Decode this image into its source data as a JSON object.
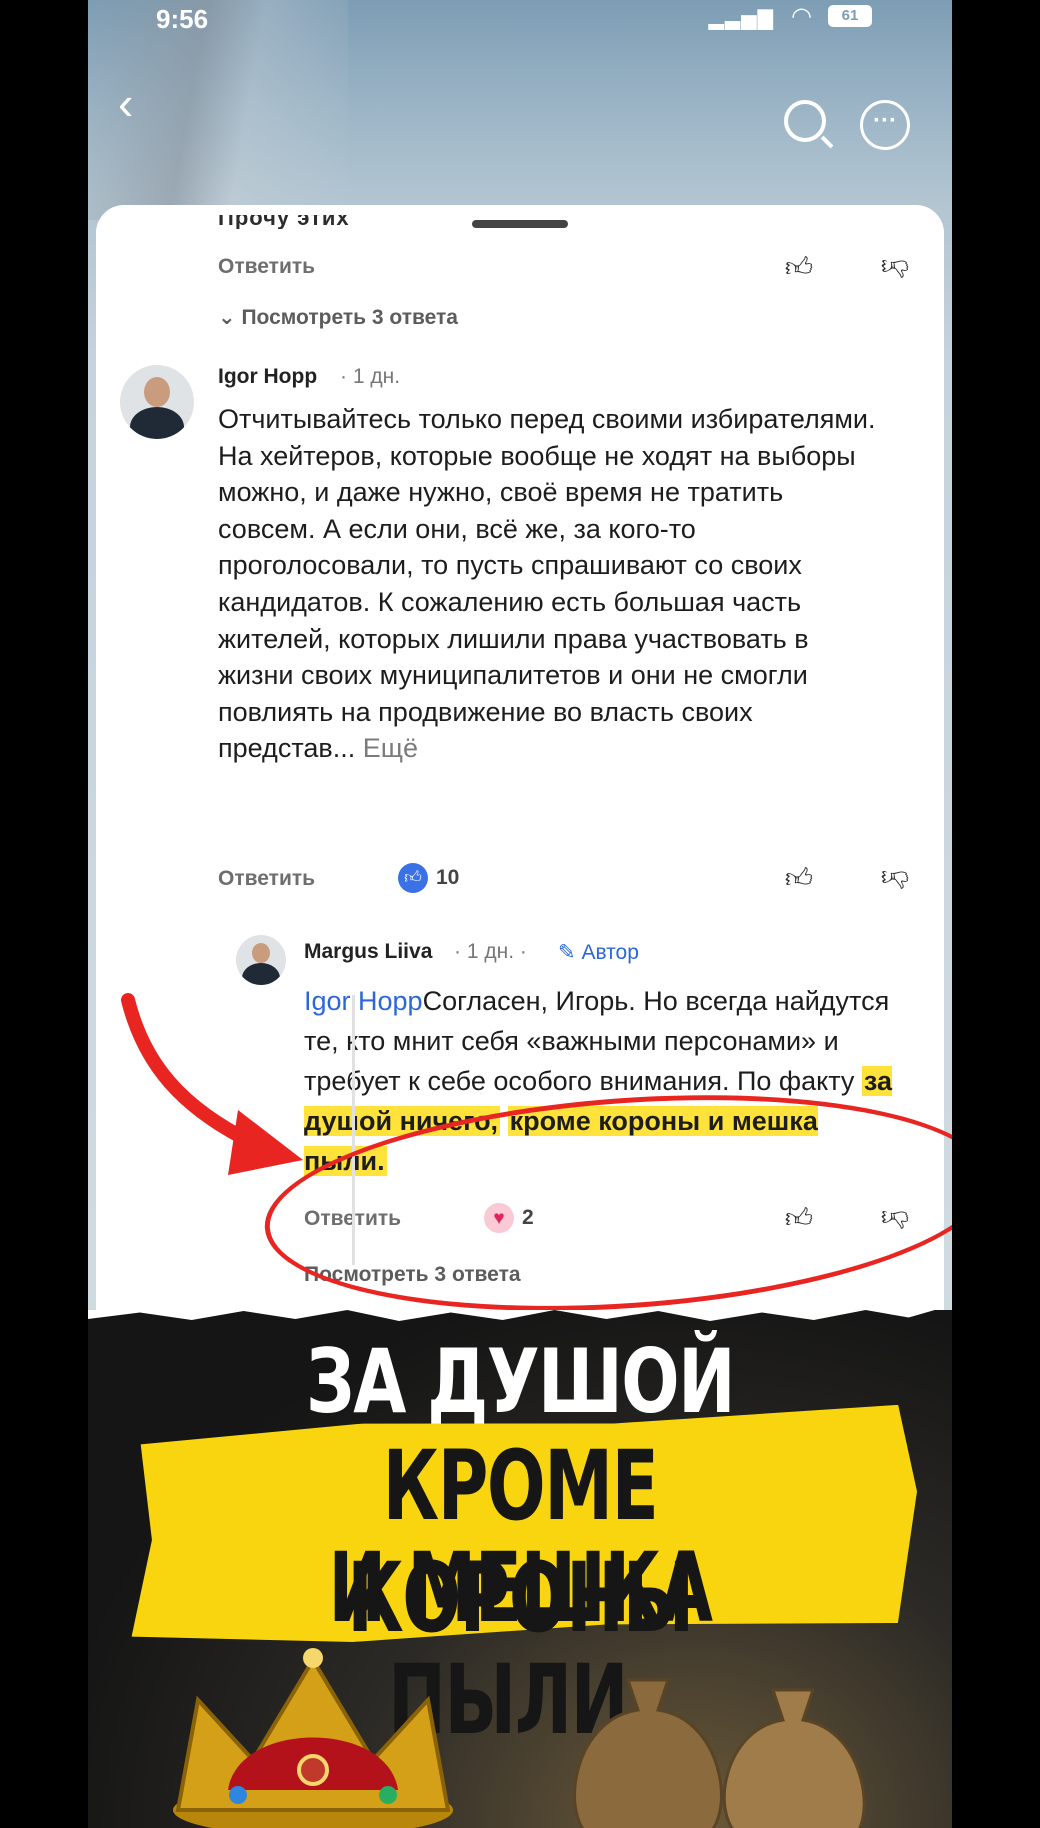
{
  "status_bar": {
    "time": "9:56",
    "battery": "61"
  },
  "sheet": {
    "cut_text": "Прочу этих",
    "top_actions": {
      "reply": "Ответить",
      "view_replies": "Посмотреть 3 ответа"
    },
    "comment": {
      "author": "Igor Hopp",
      "meta": "· 1 дн.",
      "text": "Отчитывайтесь только перед своими избирателями. На хейтеров, которые вообще не ходят на выборы можно, и даже нужно, своё время не тратить совсем. А если они, всё же, за кого-то проголосовали, то пусть спрашивают со своих кандидатов. К сожалению есть большая часть жителей, которых лишили права участвовать в жизни своих муниципалитетов и они не смогли повлиять на продвижение во власть своих представ...",
      "more": "Ещё",
      "reply": "Ответить",
      "likes": "10"
    },
    "reply": {
      "author": "Margus Liiva",
      "meta": "· 1 дн. ·",
      "badge": "Автор",
      "mention": "Igor Hopp",
      "text_plain": "Согласен, Игорь. Но всегда найдутся те, кто мнит себя «важными персонами» и требует к себе особого внимания. По факту ",
      "text_highlight_1": "за душой ничего,",
      "text_highlight_2": "кроме короны  и мешка пыли.",
      "reply": "Ответить",
      "likes": "2",
      "view_replies": "Посмотреть 3 ответа"
    }
  },
  "poster": {
    "line1": "ЗА ДУШОЙ НИЧЕГО,",
    "line2": "КРОМЕ КОРОНЫ",
    "line3": "И МЕШКА ПЫЛИ."
  }
}
